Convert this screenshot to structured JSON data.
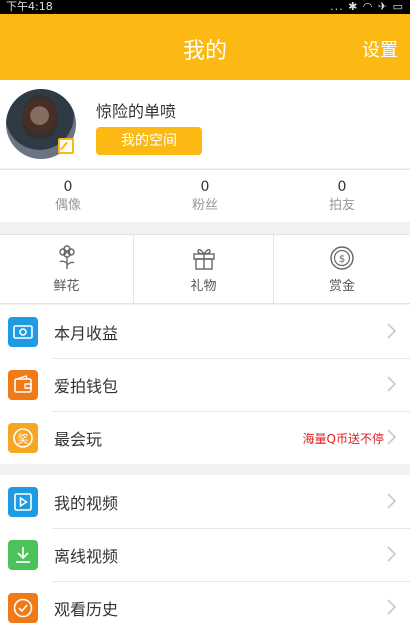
{
  "status_bar": {
    "time": "下午4:18",
    "indicators": "... ✱ ◠ ✈ ▭"
  },
  "header": {
    "title": "我的",
    "settings": "设置"
  },
  "profile": {
    "nickname": "惊险的单喷",
    "space_button": "我的空间"
  },
  "stats": [
    {
      "value": "0",
      "label": "偶像"
    },
    {
      "value": "0",
      "label": "粉丝"
    },
    {
      "value": "0",
      "label": "拍友"
    }
  ],
  "gifts": [
    {
      "label": "鲜花",
      "icon": "flower-icon"
    },
    {
      "label": "礼物",
      "icon": "gift-icon"
    },
    {
      "label": "赏金",
      "icon": "coin-icon"
    }
  ],
  "menu_group_1": [
    {
      "label": "本月收益",
      "icon": "money-icon",
      "color": "#1e9be3",
      "extra": ""
    },
    {
      "label": "爱拍钱包",
      "icon": "wallet-icon",
      "color": "#f07a18",
      "extra": ""
    },
    {
      "label": "最会玩",
      "icon": "award-icon",
      "color": "#f5a623",
      "extra": "海量Q币送不停"
    }
  ],
  "menu_group_2": [
    {
      "label": "我的视频",
      "icon": "video-play-icon",
      "color": "#1e9be3"
    },
    {
      "label": "离线视频",
      "icon": "download-icon",
      "color": "#4cc25a"
    },
    {
      "label": "观看历史",
      "icon": "clock-icon",
      "color": "#f07a18"
    }
  ],
  "colors": {
    "accent": "#fdb913",
    "promo_text": "#e02020"
  }
}
